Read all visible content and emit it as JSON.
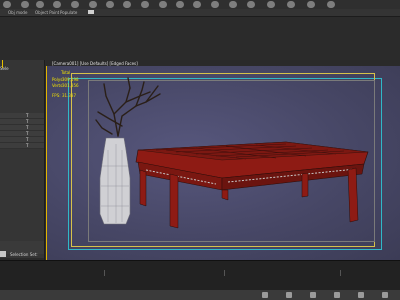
{
  "app": {
    "title": ""
  },
  "ribbon": {
    "tabs": [
      "Obj mode",
      "Object Paint",
      "Populate",
      ""
    ]
  },
  "left_panel": {
    "title": "Sele",
    "items": [
      "T",
      "T",
      "T",
      "T",
      "T",
      "T"
    ]
  },
  "viewport": {
    "label": "[Camera001] [Use Defaults] [Edged Faces]",
    "stats": [
      {
        "label": "Total",
        "value": ""
      },
      {
        "label": "Polys:",
        "value": "309,198"
      },
      {
        "label": "Verts:",
        "value": "301,356"
      },
      {
        "label": "FPS:",
        "value": "31.337"
      }
    ]
  },
  "scene": {
    "objects": [
      "vase-with-branches",
      "chinese-tea-table"
    ]
  },
  "status_bar": {
    "selection_label": "Selection Set:",
    "icons": [
      "key-icon",
      "play-icon",
      "zoom-icon",
      "pan-icon",
      "orbit-icon",
      "maximize-icon"
    ]
  },
  "colors": {
    "accent": "#e2b500",
    "viewport_bg": "#4a4a6c",
    "safe_frame": "#2fb8c8",
    "table_red": "#8b1a12"
  }
}
